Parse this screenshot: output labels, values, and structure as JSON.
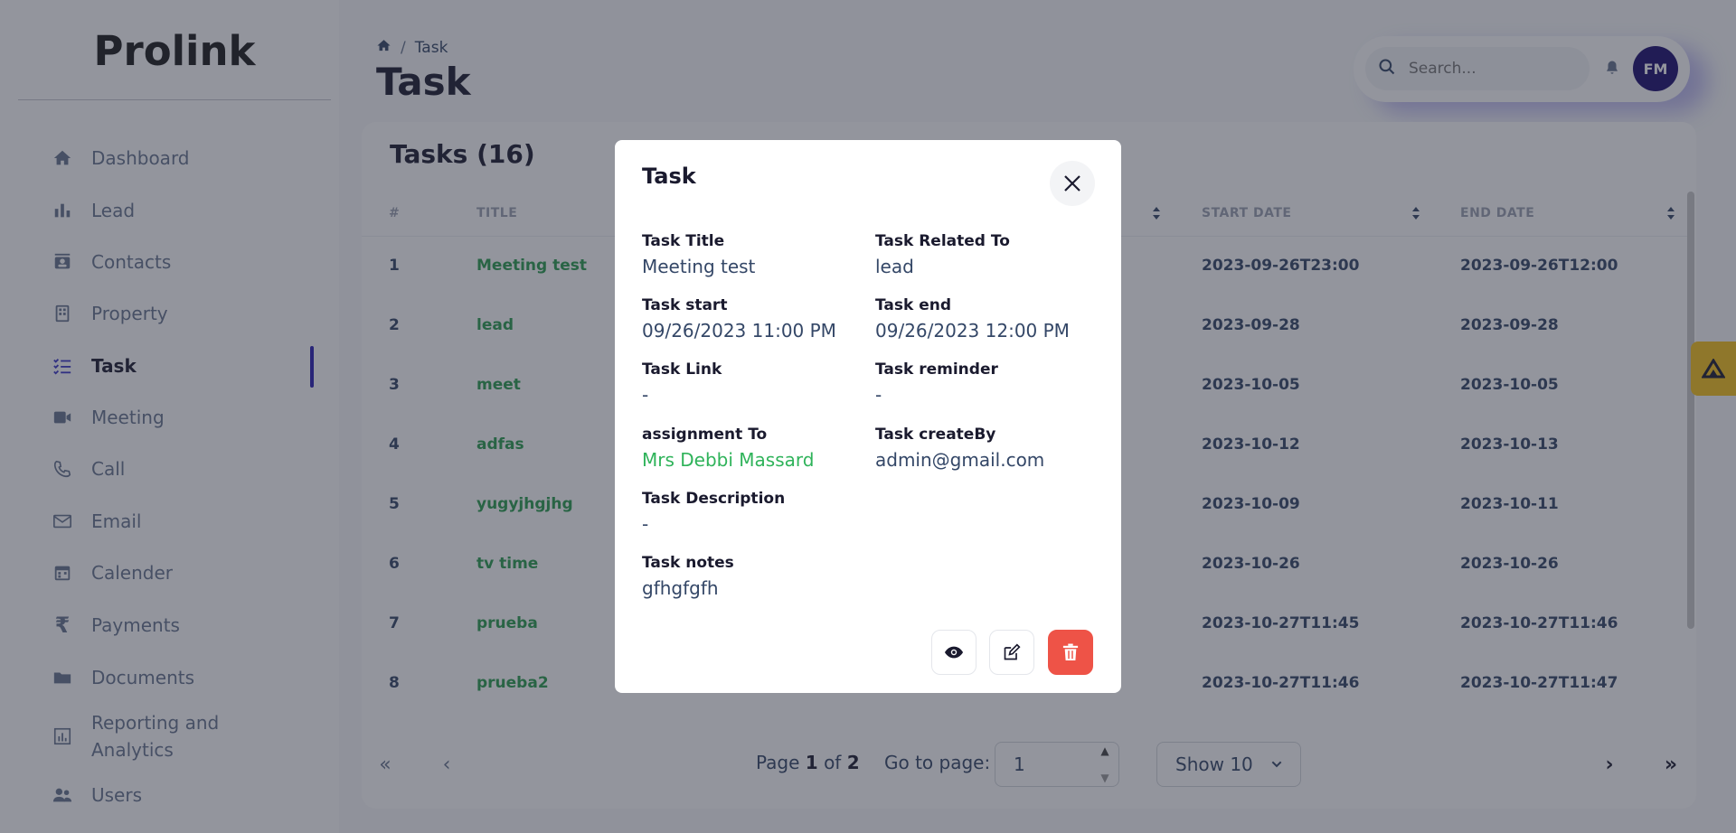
{
  "sidebar": {
    "brand": "Prolink",
    "items": [
      {
        "label": "Dashboard",
        "icon": "home-icon"
      },
      {
        "label": "Lead",
        "icon": "bar-chart-icon"
      },
      {
        "label": "Contacts",
        "icon": "contact-card-icon"
      },
      {
        "label": "Property",
        "icon": "building-icon"
      },
      {
        "label": "Task",
        "icon": "task-list-icon",
        "active": true
      },
      {
        "label": "Meeting",
        "icon": "video-camera-icon"
      },
      {
        "label": "Call",
        "icon": "phone-icon"
      },
      {
        "label": "Email",
        "icon": "mail-icon"
      },
      {
        "label": "Calender",
        "icon": "calendar-icon"
      },
      {
        "label": "Payments",
        "icon": "rupee-icon"
      },
      {
        "label": "Documents",
        "icon": "folder-icon"
      },
      {
        "label": "Reporting and Analytics",
        "icon": "analytics-icon"
      },
      {
        "label": "Users",
        "icon": "users-icon"
      }
    ]
  },
  "header": {
    "breadcrumb_current": "Task",
    "title": "Task",
    "search_placeholder": "Search...",
    "avatar_initials": "FM"
  },
  "table": {
    "title": "Tasks (16)",
    "columns": [
      "#",
      "TITLE",
      "START DATE",
      "END DATE"
    ],
    "rows": [
      {
        "num": "1",
        "title": "Meeting test",
        "start": "2023-09-26T23:00",
        "end": "2023-09-26T12:00"
      },
      {
        "num": "2",
        "title": "lead",
        "start": "2023-09-28",
        "end": "2023-09-28"
      },
      {
        "num": "3",
        "title": "meet",
        "start": "2023-10-05",
        "end": "2023-10-05"
      },
      {
        "num": "4",
        "title": "adfas",
        "start": "2023-10-12",
        "end": "2023-10-13"
      },
      {
        "num": "5",
        "title": "yugyjhgjhg",
        "start": "2023-10-09",
        "end": "2023-10-11"
      },
      {
        "num": "6",
        "title": "tv time",
        "start": "2023-10-26",
        "end": "2023-10-26"
      },
      {
        "num": "7",
        "title": "prueba",
        "start": "2023-10-27T11:45",
        "end": "2023-10-27T11:46"
      },
      {
        "num": "8",
        "title": "prueba2",
        "start": "2023-10-27T11:46",
        "end": "2023-10-27T11:47"
      }
    ]
  },
  "pagination": {
    "page_label": "Page",
    "current": "1",
    "of_label": "of",
    "total": "2",
    "goto_label": "Go to page:",
    "goto_value": "1",
    "show_value": "Show 10"
  },
  "modal": {
    "title": "Task",
    "fields": {
      "task_title_label": "Task Title",
      "task_title": "Meeting test",
      "related_label": "Task Related To",
      "related": "lead",
      "start_label": "Task start",
      "start": "09/26/2023 11:00 PM",
      "end_label": "Task end",
      "end": "09/26/2023 12:00 PM",
      "link_label": "Task Link",
      "link": "-",
      "reminder_label": "Task reminder",
      "reminder": "-",
      "assignment_label": "assignment To",
      "assignment": "Mrs Debbi Massard",
      "createby_label": "Task createBy",
      "createby": "admin@gmail.com",
      "description_label": "Task Description",
      "description": "-",
      "notes_label": "Task notes",
      "notes": "gfhgfgfh"
    }
  },
  "colors": {
    "accent": "#2a1fb5",
    "link_green": "#2fb35a",
    "danger": "#ee5347",
    "avatar_bg": "#1a0d6e",
    "side_tab": "#f7c21a"
  }
}
